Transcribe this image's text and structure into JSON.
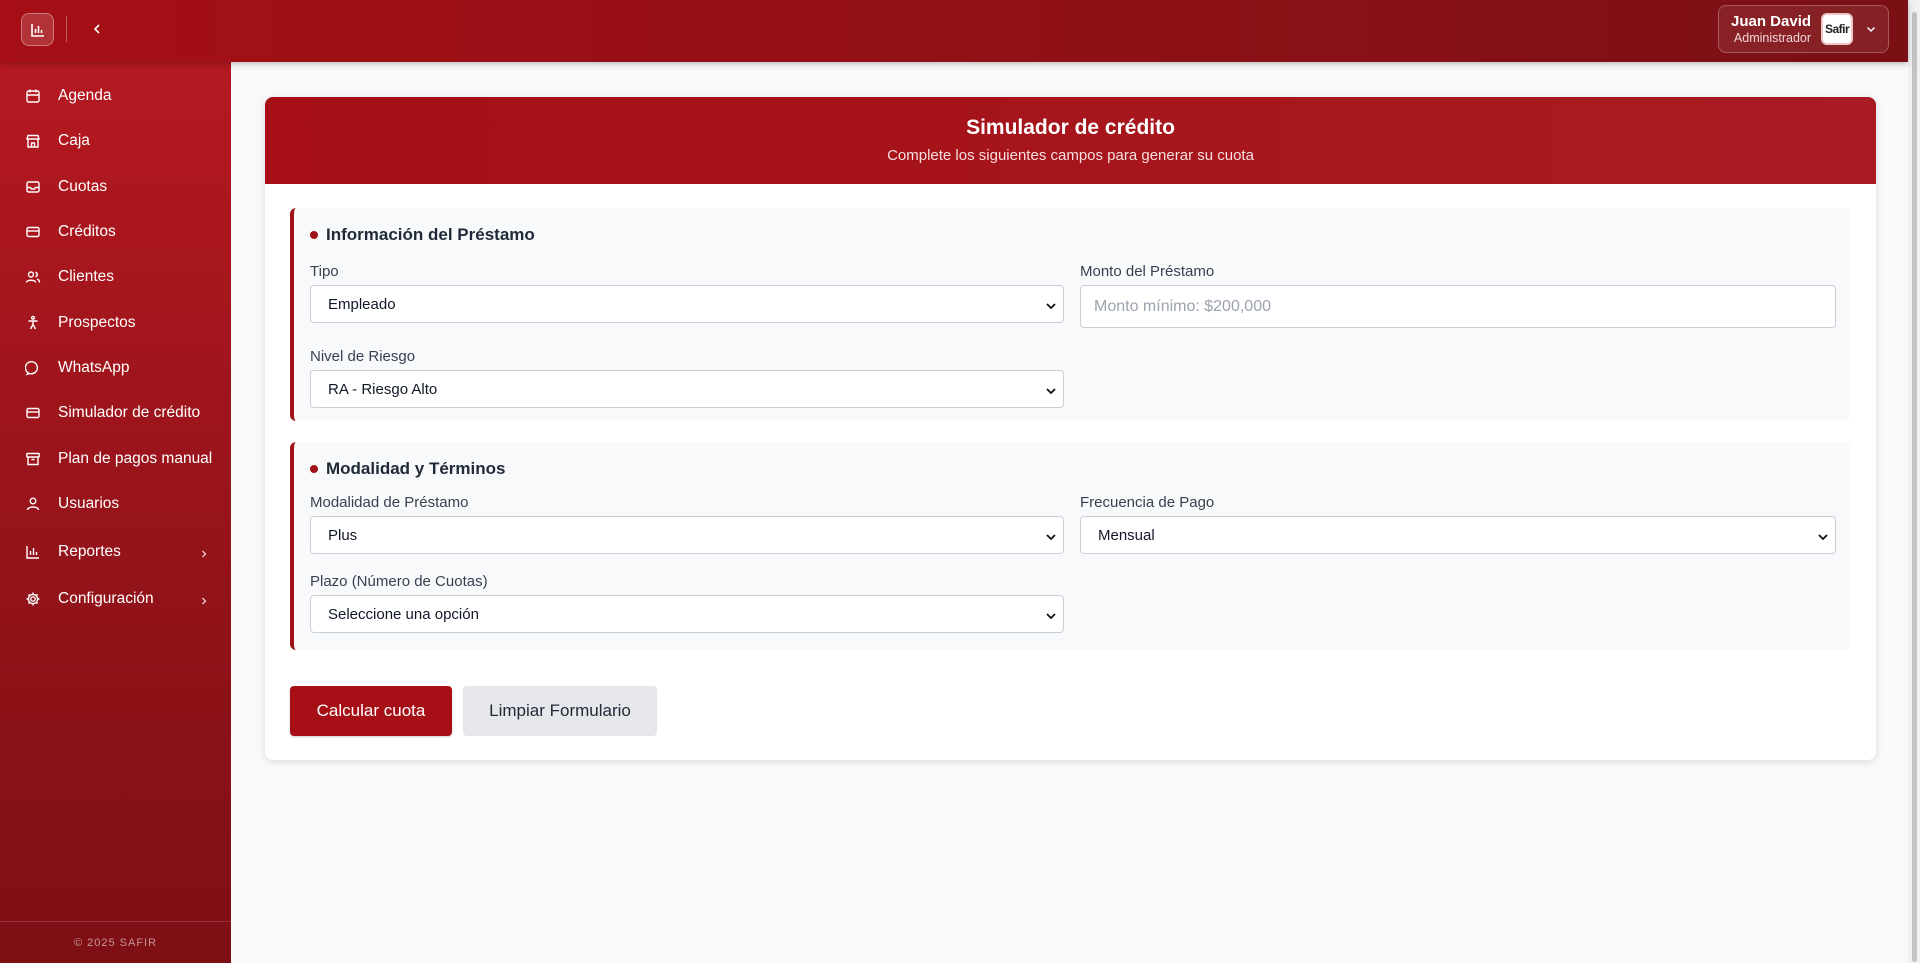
{
  "topbar": {
    "user_name": "Juan David",
    "user_role": "Administrador",
    "avatar_text": "Safir"
  },
  "sidebar": {
    "items": [
      {
        "label": "Agenda",
        "icon": "calendar-icon"
      },
      {
        "label": "Caja",
        "icon": "store-icon"
      },
      {
        "label": "Cuotas",
        "icon": "inbox-icon"
      },
      {
        "label": "Créditos",
        "icon": "credit-card-icon"
      },
      {
        "label": "Clientes",
        "icon": "users-icon"
      },
      {
        "label": "Prospectos",
        "icon": "person-standing-icon"
      },
      {
        "label": "WhatsApp",
        "icon": "message-circle-icon"
      },
      {
        "label": "Simulador de crédito",
        "icon": "credit-card-icon"
      },
      {
        "label": "Plan de pagos manual",
        "icon": "archive-icon"
      },
      {
        "label": "Usuarios",
        "icon": "user-icon"
      },
      {
        "label": "Reportes",
        "icon": "bar-chart-icon"
      },
      {
        "label": "Configuración",
        "icon": "gear-icon"
      }
    ],
    "footer": "© 2025 SAFIR"
  },
  "card": {
    "title": "Simulador de crédito",
    "subtitle": "Complete los siguientes campos para generar su cuota"
  },
  "loan_info": {
    "title": "Información del Préstamo",
    "tipo_label": "Tipo",
    "tipo_value": "Empleado",
    "monto_label": "Monto del Préstamo",
    "monto_placeholder": "Monto mínimo: $200,000",
    "riesgo_label": "Nivel de Riesgo",
    "riesgo_value": "RA - Riesgo Alto"
  },
  "terms": {
    "title": "Modalidad y Términos",
    "modalidad_label": "Modalidad de Préstamo",
    "modalidad_value": "Plus",
    "frecuencia_label": "Frecuencia de Pago",
    "frecuencia_value": "Mensual",
    "plazo_label": "Plazo (Número de Cuotas)",
    "plazo_value": "Seleccione una opción"
  },
  "actions": {
    "calculate_label": "Calcular cuota",
    "clear_label": "Limpiar Formulario"
  },
  "colors": {
    "brand": "#a50f15",
    "secondary_button": "#e5e7eb"
  }
}
